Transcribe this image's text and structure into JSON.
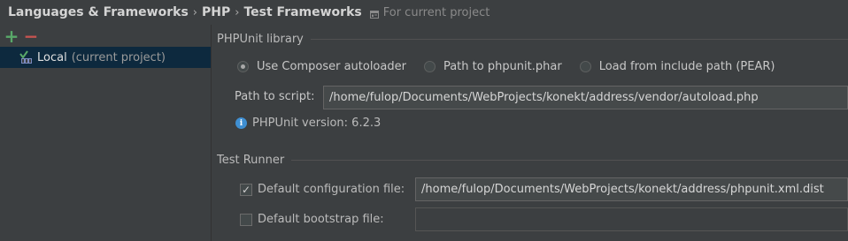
{
  "header": {
    "crumbs": [
      "Languages & Frameworks",
      "PHP",
      "Test Frameworks"
    ],
    "separator": "›",
    "scope": "For current project"
  },
  "sidebar": {
    "toolbar": {
      "add": "+",
      "remove": "−"
    },
    "items": [
      {
        "label": "Local",
        "note": "(current project)",
        "icon": "php-interpreter-icon",
        "selected": true
      }
    ]
  },
  "phpunit": {
    "section_title": "PHPUnit library",
    "options": [
      {
        "label": "Use Composer autoloader",
        "selected": true
      },
      {
        "label": "Path to phpunit.phar",
        "selected": false
      },
      {
        "label": "Load from include path (PEAR)",
        "selected": false
      }
    ],
    "path_label": "Path to script:",
    "path_value": "/home/fulop/Documents/WebProjects/konekt/address/vendor/autoload.php",
    "version_text": "PHPUnit version: 6.2.3"
  },
  "test_runner": {
    "section_title": "Test Runner",
    "config": {
      "label": "Default configuration file:",
      "checked": true,
      "value": "/home/fulop/Documents/WebProjects/konekt/address/phpunit.xml.dist"
    },
    "bootstrap": {
      "label": "Default bootstrap file:",
      "checked": false,
      "value": ""
    }
  },
  "colors": {
    "background": "#3c3f41",
    "selection": "#0d293e",
    "add": "#59a869",
    "remove": "#c75450",
    "info": "#3f8fd2"
  }
}
